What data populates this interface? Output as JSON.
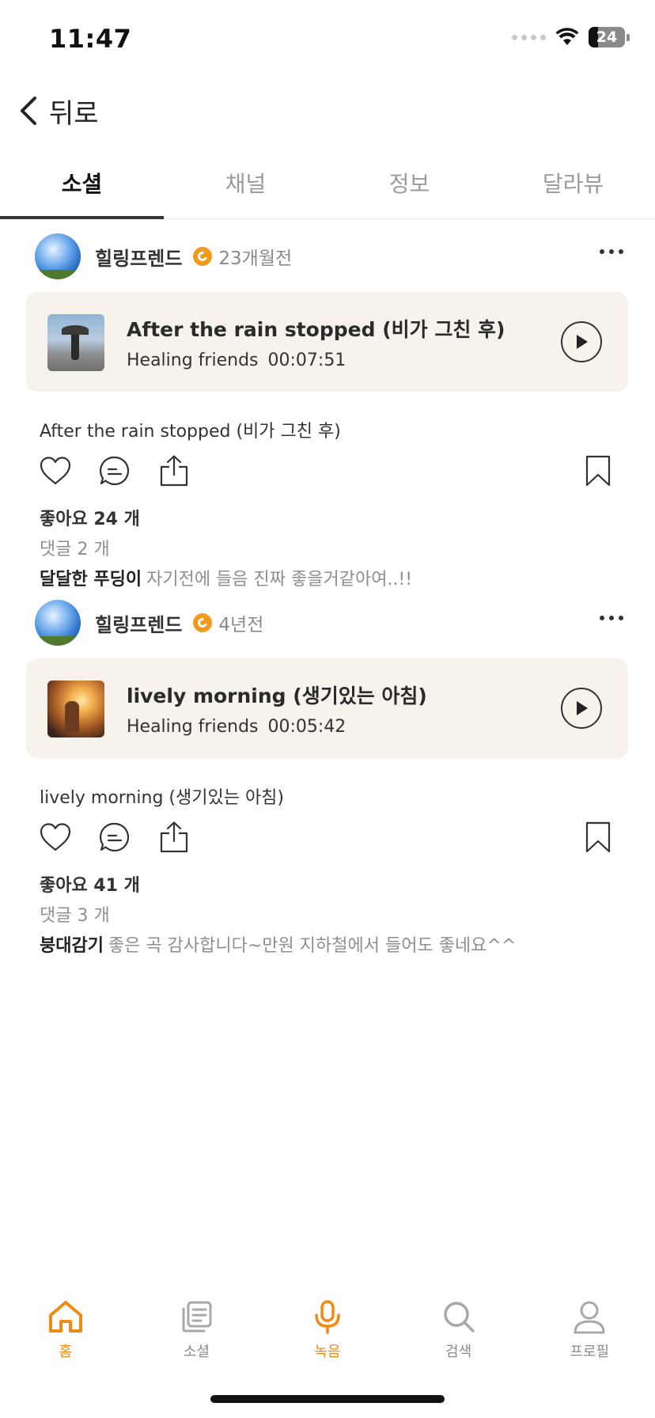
{
  "status_bar": {
    "time": "11:47",
    "battery": "24"
  },
  "nav": {
    "back_label": "뒤로"
  },
  "tabs": [
    {
      "label": "소셜",
      "active": true
    },
    {
      "label": "채널",
      "active": false
    },
    {
      "label": "정보",
      "active": false
    },
    {
      "label": "달라뷰",
      "active": false
    }
  ],
  "posts": [
    {
      "author": "힐링프렌드",
      "time_ago": "23개월전",
      "track": {
        "title": "After the rain stopped (비가 그친 후)",
        "artist": "Healing friends",
        "duration": "00:07:51"
      },
      "caption": "After the rain stopped (비가 그친 후)",
      "likes": "좋아요 24 개",
      "comments": "댓글 2 개",
      "top_comment": {
        "author": "달달한 푸딩이",
        "text": "자기전에 들음 진짜 좋을거같아여..!!"
      }
    },
    {
      "author": "힐링프렌드",
      "time_ago": "4년전",
      "track": {
        "title": "lively morning (생기있는 아침)",
        "artist": "Healing friends",
        "duration": "00:05:42"
      },
      "caption": "lively morning (생기있는 아침)",
      "likes": "좋아요 41 개",
      "comments": "댓글 3 개",
      "top_comment": {
        "author": "붕대감기",
        "text": "좋은 곡 감사합니다~만원 지하철에서 들어도 좋네요^^"
      }
    }
  ],
  "bottom_nav": [
    {
      "label": "홈",
      "icon": "home-icon",
      "state": "active"
    },
    {
      "label": "소셜",
      "icon": "social-feed-icon",
      "state": "inactive"
    },
    {
      "label": "녹음",
      "icon": "microphone-icon",
      "state": "accent"
    },
    {
      "label": "검색",
      "icon": "search-icon",
      "state": "inactive"
    },
    {
      "label": "프로필",
      "icon": "profile-icon",
      "state": "inactive"
    }
  ],
  "colors": {
    "accent": "#f08a12",
    "card_bg": "#f7f2eb",
    "muted_text": "#8e8e8e"
  }
}
